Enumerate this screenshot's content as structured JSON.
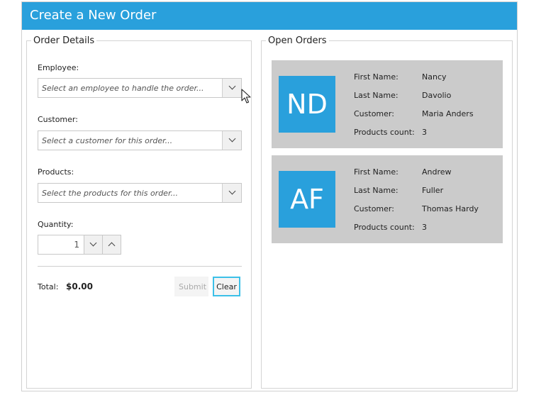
{
  "window": {
    "title": "Create a New Order"
  },
  "order_details": {
    "legend": "Order Details",
    "employee": {
      "label": "Employee:",
      "placeholder": "Select an employee to handle the order..."
    },
    "customer": {
      "label": "Customer:",
      "placeholder": "Select a customer for this order..."
    },
    "products": {
      "label": "Products:",
      "placeholder": "Select the products for this order..."
    },
    "quantity": {
      "label": "Quantity:",
      "value": "1"
    },
    "total": {
      "label": "Total:",
      "value": "$0.00"
    },
    "buttons": {
      "submit": "Submit",
      "clear": "Clear"
    }
  },
  "open_orders": {
    "legend": "Open Orders",
    "field_labels": {
      "first_name": "First Name:",
      "last_name": "Last Name:",
      "customer": "Customer:",
      "products_count": "Products count:"
    },
    "orders": [
      {
        "initials": "ND",
        "first_name": "Nancy",
        "last_name": "Davolio",
        "customer": "Maria Anders",
        "products_count": "3"
      },
      {
        "initials": "AF",
        "first_name": "Andrew",
        "last_name": "Fuller",
        "customer": "Thomas Hardy",
        "products_count": "3"
      }
    ]
  },
  "colors": {
    "accent": "#29a0dc",
    "card_background": "#cbcbcb",
    "focus_border": "#3cc0e8"
  },
  "icons": [
    "chevron-down-icon",
    "chevron-up-icon",
    "mouse-pointer-icon"
  ]
}
